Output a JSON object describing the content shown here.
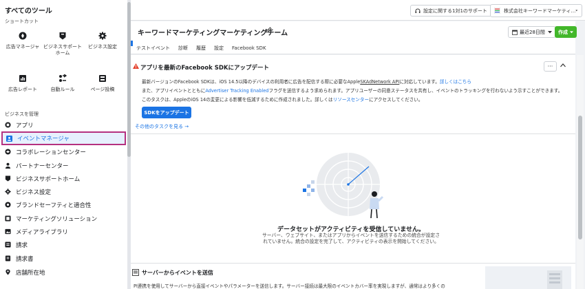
{
  "tools": {
    "title": "すべてのツール",
    "shortcuts_label": "ショートカット",
    "shortcuts": [
      {
        "label": "広告マネージャ",
        "icon": "compass-icon"
      },
      {
        "label": "ビジネスサポートホーム",
        "icon": "support-shield-icon"
      },
      {
        "label": "ビジネス設定",
        "icon": "gear-icon"
      },
      {
        "label": "広告レポート",
        "icon": "report-icon"
      },
      {
        "label": "自動ルール",
        "icon": "rules-icon"
      },
      {
        "label": "ページ投稿",
        "icon": "page-posts-icon"
      }
    ],
    "manage_label": "ビジネスを管理",
    "items": [
      {
        "label": "アプリ",
        "icon": "apps-icon"
      },
      {
        "label": "イベントマネージャ",
        "icon": "events-icon",
        "active": true
      },
      {
        "label": "コラボレーションセンター",
        "icon": "handshake-icon"
      },
      {
        "label": "パートナーセンター",
        "icon": "partner-icon"
      },
      {
        "label": "ビジネスサポートホーム",
        "icon": "support-shield-icon"
      },
      {
        "label": "ビジネス設定",
        "icon": "gear-icon"
      },
      {
        "label": "ブランドセーフティと適合性",
        "icon": "brand-safety-icon"
      },
      {
        "label": "マーケティングソリューション",
        "icon": "marketing-icon"
      },
      {
        "label": "メディアライブラリ",
        "icon": "media-library-icon"
      },
      {
        "label": "請求",
        "icon": "billing-icon"
      },
      {
        "label": "請求書",
        "icon": "invoice-icon"
      },
      {
        "label": "店舗所在地",
        "icon": "store-location-icon"
      }
    ]
  },
  "topbar": {
    "support_label": "設定に関する1対1のサポート",
    "account_label": "株式会社キーワードマーケティ…"
  },
  "header": {
    "title": "キーワードマーケティングマーケティングチーム",
    "tabs": [
      "テストイベント",
      "診断",
      "履歴",
      "設定",
      "Facebook SDK"
    ],
    "range_label": "最近28日間",
    "create_label": "作成"
  },
  "alert": {
    "title": "アプリを最新のFacebook SDKにアップデート",
    "line1_a": "最新バージョンのFacebook SDKは、iOS 14.5以降のデバイスの利用者に広告を配信する際に必要なApple",
    "line1_link": "SKAdNetwork API",
    "line1_b": "に対応しています。",
    "line1_more": "詳しくはこちら",
    "line2_a": "また、アプリイベントとともに",
    "line2_link": "Advertiser Tracking Enabled",
    "line2_b": "フラグを送信するよう求められます。アプリユーザーの同意ステータスを共有し、イベントのトラッキングを行わないよう示すことができます。",
    "line3_a": "このタスクは、AppleのiOS 14の変更による影響を低減するために作成されました。詳しくは",
    "line3_link": "リソースセンター",
    "line3_b": "にアクセスしてください。",
    "update_button": "SDKをアップデート",
    "other_tasks": "その他のタスクを見る →",
    "more": "···"
  },
  "empty": {
    "title": "データセットがアクティビティを受信していません。",
    "body": "サーバー、ウェブサイト、またはアプリからイベントを送信するための統合が設定されていません。統合の設定を完了して、アクティビティの表示を開始してください。"
  },
  "server": {
    "title": "サーバーからイベントを送信",
    "body": "PI連携を使用してサーバーから直接イベントやパラメーターを送信します。サーバー接続は最大限のイベントカバー率を実現しますが、通常はより多くの"
  },
  "colors": {
    "accent": "#1b74e4",
    "active_outline": "#b5307f",
    "create_green": "#42b72a",
    "warning": "#e4402b"
  }
}
